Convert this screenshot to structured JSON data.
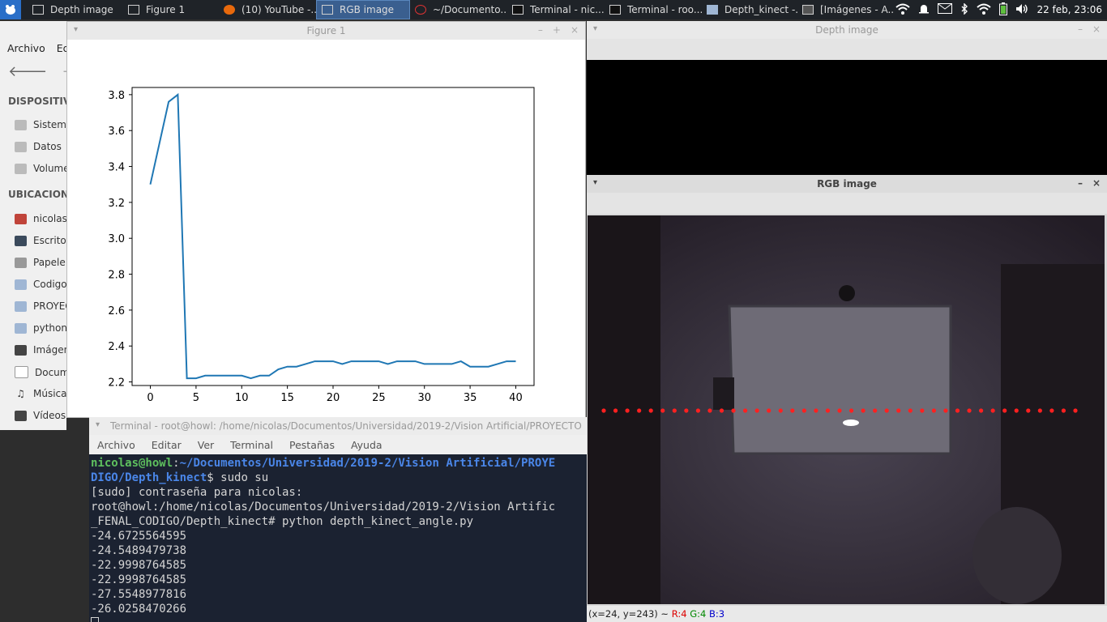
{
  "panel": {
    "tasks": [
      {
        "label": "Depth image",
        "active": false
      },
      {
        "label": "Figure 1",
        "active": false
      },
      {
        "label": "(10) YouTube -...",
        "active": false
      },
      {
        "label": "RGB image",
        "active": true
      },
      {
        "label": "~/Documento...",
        "active": false
      },
      {
        "label": "Terminal - nic...",
        "active": false
      },
      {
        "label": "Terminal - roo...",
        "active": false
      },
      {
        "label": "Depth_kinect -...",
        "active": false
      },
      {
        "label": "[Imágenes - A...",
        "active": false
      }
    ],
    "clock": "22 feb, 23:06"
  },
  "file_manager": {
    "menu": [
      "Archivo",
      "Ed"
    ],
    "sections": [
      {
        "heading": "DISPOSITIV",
        "items": [
          "Sistem",
          "Datos",
          "Volume"
        ]
      },
      {
        "heading": "UBICACION",
        "items": [
          "nicolas",
          "Escrito",
          "Papele",
          "Codigo",
          "PROYEC",
          "python",
          "Imágen",
          "Docum",
          "Música",
          "Vídeos"
        ]
      }
    ]
  },
  "figure": {
    "title": "Figure 1"
  },
  "chart_data": {
    "type": "line",
    "title": "",
    "xlabel": "",
    "ylabel": "",
    "xlim": [
      -2,
      42
    ],
    "ylim": [
      2.18,
      3.84
    ],
    "xticks": [
      "0",
      "5",
      "10",
      "15",
      "20",
      "25",
      "30",
      "35",
      "40"
    ],
    "yticks": [
      "2.2",
      "2.4",
      "2.6",
      "2.8",
      "3.0",
      "3.2",
      "3.4",
      "3.6",
      "3.8"
    ],
    "grid": false,
    "series": [
      {
        "color": "#1f77b4",
        "x": [
          0,
          1,
          2,
          3,
          4,
          5,
          6,
          7,
          8,
          9,
          10,
          11,
          12,
          13,
          14,
          15,
          16,
          17,
          18,
          19,
          20,
          21,
          22,
          23,
          24,
          25,
          26,
          27,
          28,
          29,
          30,
          31,
          32,
          33,
          34,
          35,
          36,
          37,
          38,
          39,
          40
        ],
        "y": [
          3.3,
          3.53,
          3.76,
          3.8,
          2.22,
          2.22,
          2.235,
          2.235,
          2.235,
          2.235,
          2.235,
          2.22,
          2.235,
          2.235,
          2.27,
          2.285,
          2.285,
          2.3,
          2.315,
          2.315,
          2.315,
          2.3,
          2.315,
          2.315,
          2.315,
          2.315,
          2.3,
          2.315,
          2.315,
          2.315,
          2.3,
          2.3,
          2.3,
          2.3,
          2.315,
          2.285,
          2.285,
          2.285,
          2.3,
          2.315,
          2.315
        ]
      }
    ]
  },
  "terminal": {
    "title": "Terminal - root@howl: /home/nicolas/Documentos/Universidad/2019-2/Vision Artificial/PROYECTO",
    "menu": [
      "Archivo",
      "Editar",
      "Ver",
      "Terminal",
      "Pestañas",
      "Ayuda"
    ],
    "prompt_user": "nicolas@howl",
    "prompt_path_1": "~/Documentos/Universidad/2019-2/Vision Artificial/PROYE",
    "prompt_path_2": "DIGO/Depth_kinect",
    "command": "$ sudo su",
    "lines": [
      "[sudo] contraseña para nicolas:",
      "root@howl:/home/nicolas/Documentos/Universidad/2019-2/Vision Artific",
      "_FENAL_CODIGO/Depth_kinect# python depth_kinect_angle.py",
      "-24.6725564595",
      "-24.5489479738",
      "-22.9998764585",
      "-22.9998764585",
      "-27.5548977816",
      "-26.0258470266"
    ]
  },
  "depth_window": {
    "title": "Depth image"
  },
  "rgb_window": {
    "title": "RGB image",
    "status_prefix": "(x=24, y=243) ~",
    "status_r": "R:4",
    "status_g": "G:4",
    "status_b": "B:3",
    "marker_color": "#ff2020"
  }
}
